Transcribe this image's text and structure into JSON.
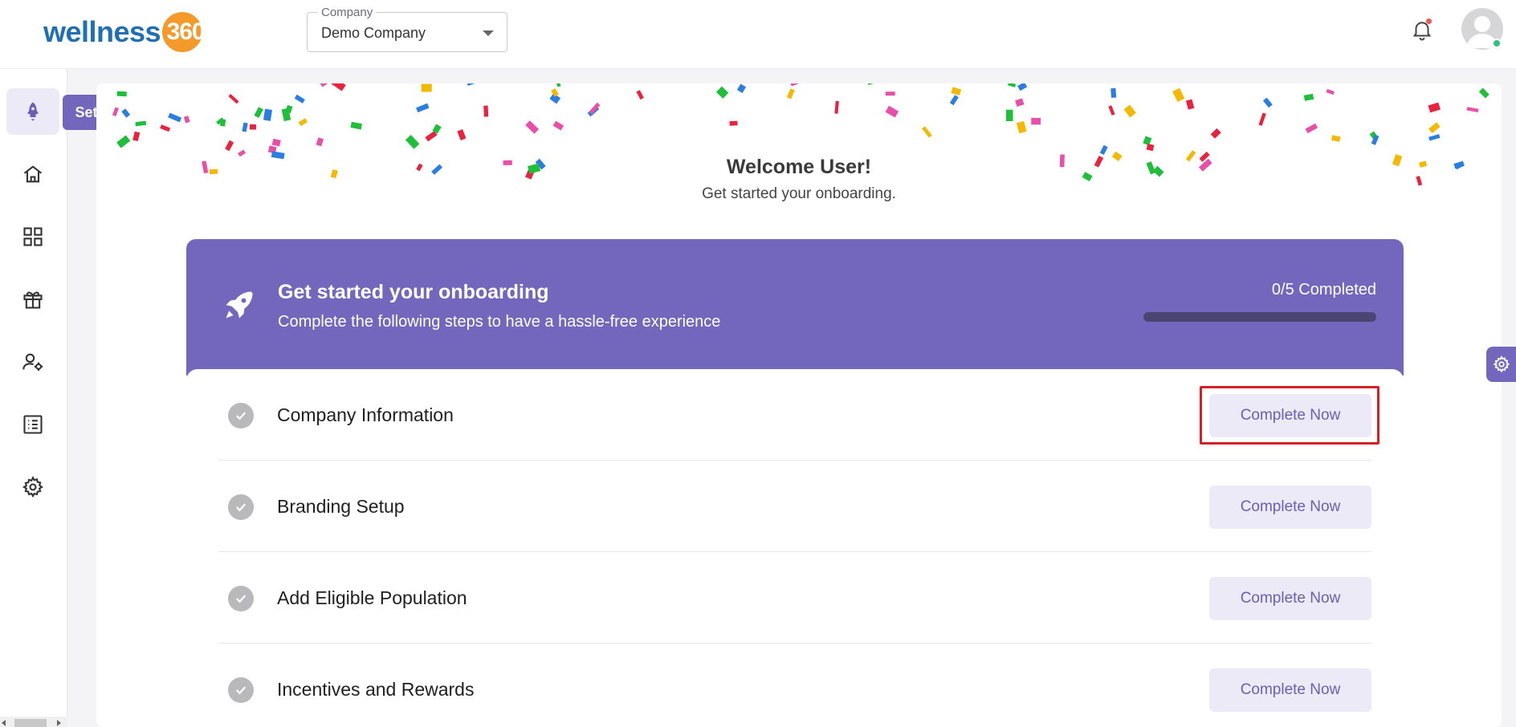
{
  "brand": {
    "logo_text": "wellness",
    "logo_number": "360"
  },
  "header": {
    "company_label": "Company",
    "company_value": "Demo Company"
  },
  "sidebar": {
    "tooltip": "Set up",
    "items": [
      {
        "icon": "rocket-icon",
        "active": true
      },
      {
        "icon": "home-icon"
      },
      {
        "icon": "dashboard-grid-icon"
      },
      {
        "icon": "gift-icon"
      },
      {
        "icon": "user-settings-icon"
      },
      {
        "icon": "list-icon"
      },
      {
        "icon": "gear-icon"
      }
    ]
  },
  "welcome": {
    "title": "Welcome User!",
    "subtitle": "Get started your onboarding."
  },
  "onboarding": {
    "title": "Get started your onboarding",
    "subtitle": "Complete the following steps to have a hassle-free experience",
    "progress_label": "0/5 Completed",
    "completed": 0,
    "total": 5,
    "steps": [
      {
        "label": "Company Information",
        "button": "Complete Now",
        "highlighted": true
      },
      {
        "label": "Branding Setup",
        "button": "Complete Now"
      },
      {
        "label": "Add Eligible Population",
        "button": "Complete Now"
      },
      {
        "label": "Incentives and Rewards",
        "button": "Complete Now"
      }
    ]
  },
  "colors": {
    "accent": "#7366bd",
    "button_bg": "#eceaf6",
    "button_text": "#6a5fb5",
    "highlight": "#d91f26",
    "logo_blue": "#1f6fb6",
    "logo_orange": "#f39a2b"
  }
}
